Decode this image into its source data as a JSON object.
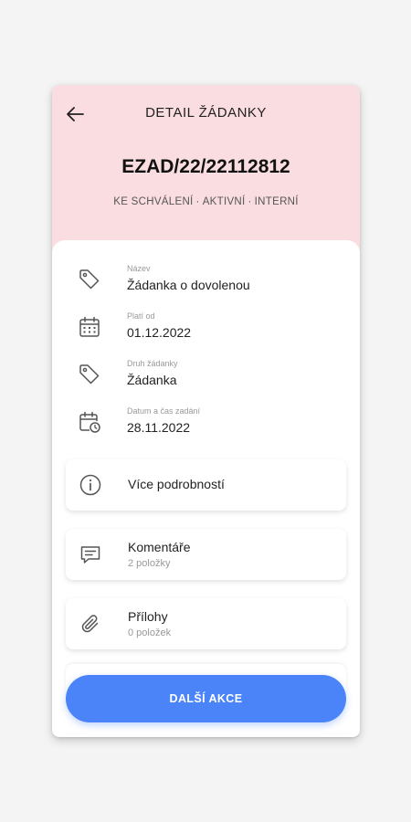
{
  "header": {
    "title": "DETAIL ŽÁDANKY",
    "document_id": "EZAD/22/22112812",
    "status": [
      "KE SCHVÁLENÍ",
      "AKTIVNÍ",
      "INTERNÍ"
    ],
    "status_separator": "·"
  },
  "fields": [
    {
      "label": "Název",
      "value": "Žádanka o dovolenou",
      "icon": "tag-icon"
    },
    {
      "label": "Platí od",
      "value": "01.12.2022",
      "icon": "calendar-icon"
    },
    {
      "label": "Druh žádanky",
      "value": "Žádanka",
      "icon": "tag-icon"
    },
    {
      "label": "Datum a čas zadání",
      "value": "28.11.2022",
      "icon": "calendar-clock-icon"
    }
  ],
  "cards": {
    "details": {
      "title": "Více podrobností",
      "icon": "info-icon"
    },
    "comments": {
      "title": "Komentáře",
      "subtitle": "2 položky",
      "icon": "comment-icon"
    },
    "attachments": {
      "title": "Přílohy",
      "subtitle": "0 položek",
      "icon": "paperclip-icon"
    }
  },
  "action_button": {
    "label": "DALŠÍ AKCE"
  },
  "colors": {
    "header_bg": "#f9dde0",
    "accent": "#4a84f8",
    "page_bg": "#f4f4f4"
  }
}
